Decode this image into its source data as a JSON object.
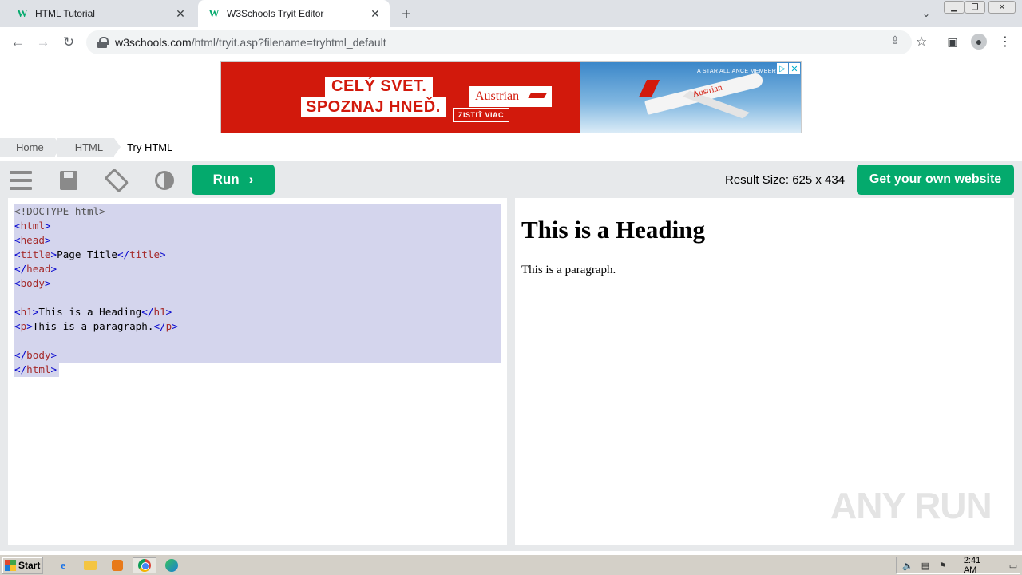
{
  "browser": {
    "tabs": [
      {
        "title": "HTML Tutorial",
        "favicon": "W"
      },
      {
        "title": "W3Schools Tryit Editor",
        "favicon": "W"
      }
    ],
    "url": {
      "host": "w3schools.com",
      "path": "/html/tryit.asp?filename=tryhtml_default"
    }
  },
  "ad": {
    "line1": "CELÝ SVET.",
    "line2": "SPOZNAJ HNEĎ.",
    "cta": "ZISTIŤ VIAC",
    "brand": "Austrian",
    "alliance": "A STAR ALLIANCE MEMBER",
    "plane_livery": "Austrian"
  },
  "breadcrumb": {
    "home": "Home",
    "html": "HTML",
    "current": "Try HTML"
  },
  "toolbar": {
    "run_label": "Run",
    "run_chevron": "›",
    "result_size": "Result Size: 625 x 434",
    "own_site_label": "Get your own website"
  },
  "code": {
    "doctype": "<!DOCTYPE html>",
    "tag_html": "html",
    "tag_head": "head",
    "tag_title": "title",
    "title_text": "Page Title",
    "tag_body": "body",
    "tag_h1": "h1",
    "h1_text": "This is a Heading",
    "tag_p": "p",
    "p_text": "This is a paragraph.",
    "lt": "<",
    "gt": ">",
    "lt_slash": "</"
  },
  "result": {
    "heading": "This is a Heading",
    "paragraph": "This is a paragraph."
  },
  "watermark": "ANY RUN",
  "taskbar": {
    "start_label": "Start",
    "clock": "2:41 AM"
  },
  "colors": {
    "accent_green": "#04aa6d",
    "toolbar_gray": "#e7e9eb",
    "selection": "#d4d5ed",
    "ad_red": "#d2190c"
  }
}
